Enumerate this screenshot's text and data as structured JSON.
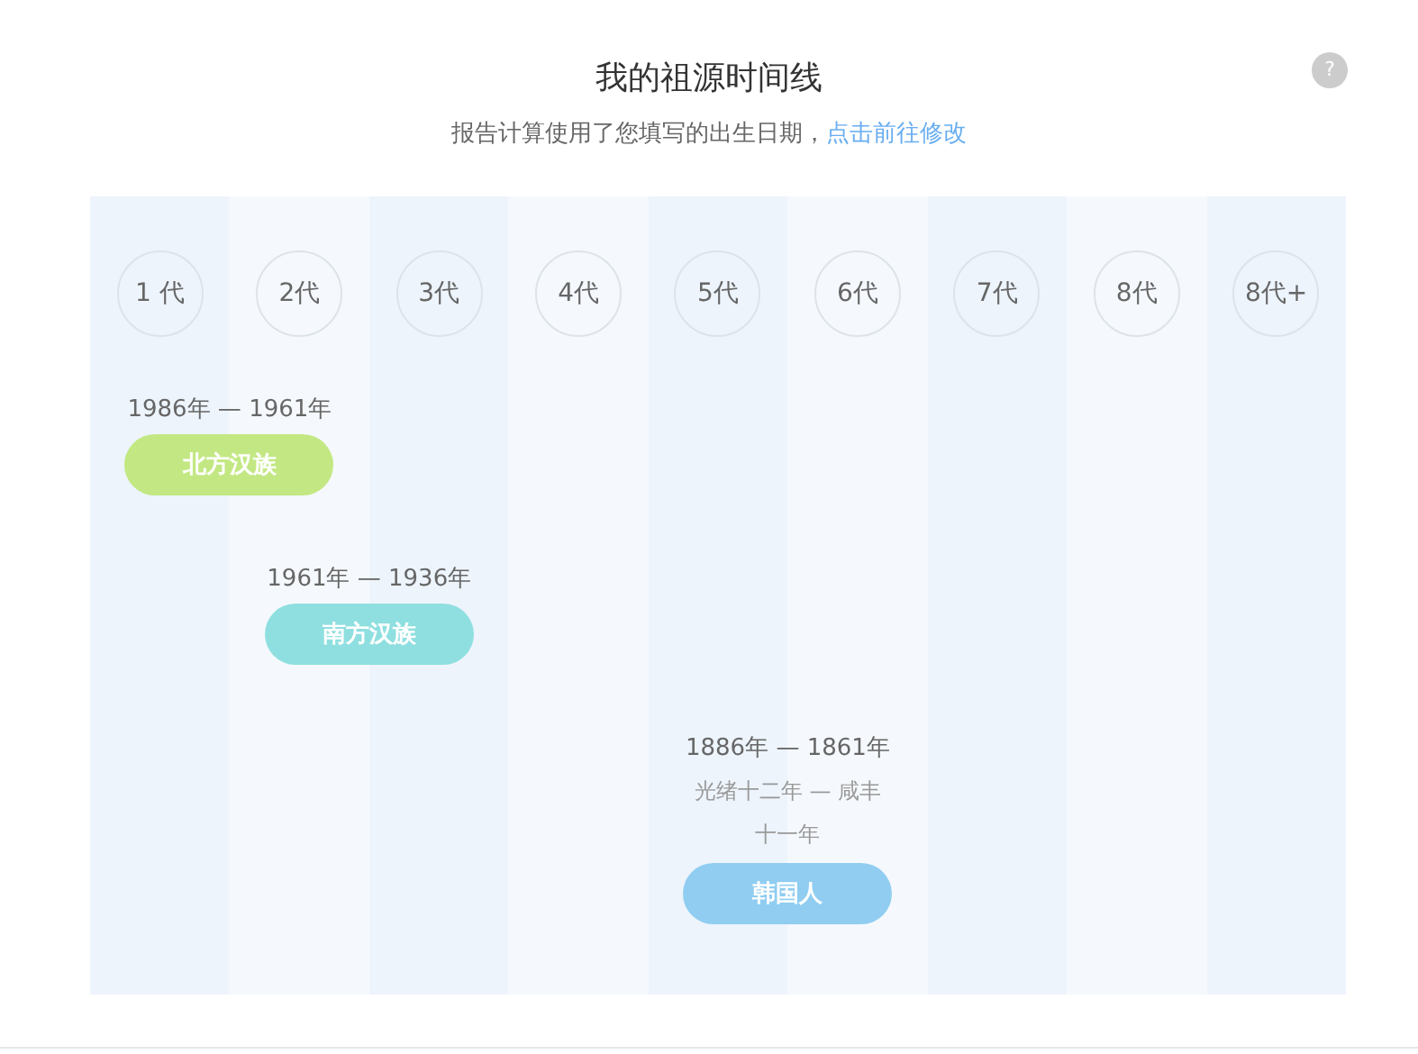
{
  "title": "我的祖源时间线",
  "help": "?",
  "subtitle": {
    "text": "报告计算使用了您填写的出生日期，",
    "link": "点击前往修改"
  },
  "generations": [
    {
      "label": "1 代",
      "lineage": {
        "years": "1986年 — 1961年",
        "tag": "北方汉族",
        "color": "#c3e883"
      }
    },
    {
      "label": "2代",
      "lineage": {
        "years": "1961年 — 1936年",
        "tag": "南方汉族",
        "color": "#8fdfe0"
      }
    },
    {
      "label": "3代"
    },
    {
      "label": "4代"
    },
    {
      "label": "5代",
      "lineage": {
        "years": "1886年 — 1861年",
        "era": "光绪十二年 — 咸丰十一年",
        "tag": "韩国人",
        "color": "#90cdf1"
      }
    },
    {
      "label": "6代"
    },
    {
      "label": "7代"
    },
    {
      "label": "8代"
    },
    {
      "label": "8代+"
    }
  ]
}
